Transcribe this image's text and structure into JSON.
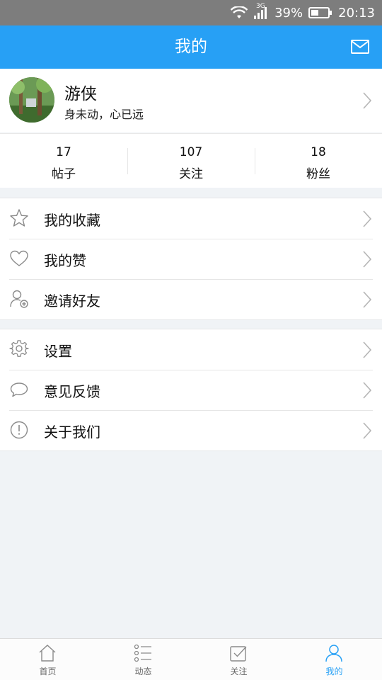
{
  "status_bar": {
    "network": "3G",
    "battery": "39%",
    "time": "20:13"
  },
  "header": {
    "title": "我的",
    "mail_icon": "mail-icon"
  },
  "profile": {
    "name": "游侠",
    "bio": "身未动，心已远"
  },
  "stats": [
    {
      "value": "17",
      "label": "帖子"
    },
    {
      "value": "107",
      "label": "关注"
    },
    {
      "value": "18",
      "label": "粉丝"
    }
  ],
  "menu_group_1": [
    {
      "label": "我的收藏",
      "icon": "star-icon"
    },
    {
      "label": "我的赞",
      "icon": "heart-icon"
    },
    {
      "label": "邀请好友",
      "icon": "add-user-icon"
    }
  ],
  "menu_group_2": [
    {
      "label": "设置",
      "icon": "gear-icon"
    },
    {
      "label": "意见反馈",
      "icon": "chat-bubble-icon"
    },
    {
      "label": "关于我们",
      "icon": "info-icon"
    }
  ],
  "bottom_nav": [
    {
      "label": "首页",
      "icon": "home-icon"
    },
    {
      "label": "动态",
      "icon": "list-icon"
    },
    {
      "label": "关注",
      "icon": "checkbox-icon"
    },
    {
      "label": "我的",
      "icon": "person-icon",
      "active": true
    }
  ],
  "colors": {
    "accent": "#27a0f5",
    "status_bar": "#7d7d7d",
    "background": "#f0f3f6"
  }
}
